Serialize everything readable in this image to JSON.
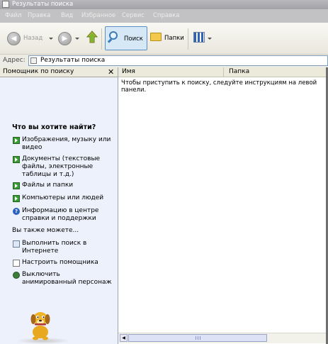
{
  "window": {
    "title": "Результаты поиска"
  },
  "menu": [
    "Файл",
    "Правка",
    "Вид",
    "Избранное",
    "Сервис",
    "Справка"
  ],
  "toolbar": {
    "back_label": "Назад",
    "search_label": "Поиск",
    "folders_label": "Папки"
  },
  "address": {
    "label": "Адрес:",
    "value": "Результаты поиска"
  },
  "search_pane": {
    "title": "Помощник по поиску",
    "close_glyph": "✕",
    "heading": "Что вы хотите найти?",
    "options": [
      "Изображения, музыку или видео",
      "Документы (текстовые файлы, электронные таблицы и т.д.)",
      "Файлы и папки",
      "Компьютеры или людей",
      "Информацию в центре справки и поддержки"
    ],
    "also_label": "Вы также можете...",
    "also_options": [
      "Выполнить поиск в Интернете",
      "Настроить помощника",
      "Выключить анимированный персонаж"
    ]
  },
  "results": {
    "columns": [
      "Имя",
      "Папка"
    ],
    "message": "Чтобы приступить к поиску, следуйте инструкциям на левой панели."
  },
  "icons": {
    "back": "back-arrow-icon",
    "forward": "forward-arrow-icon",
    "up": "up-folder-icon",
    "search": "magnifier-icon",
    "folders": "folder-icon",
    "views": "views-icon"
  },
  "colors": {
    "pane_bg": "#edf1fc",
    "highlight": "#d6e7f6",
    "accent": "#3b9a35"
  }
}
